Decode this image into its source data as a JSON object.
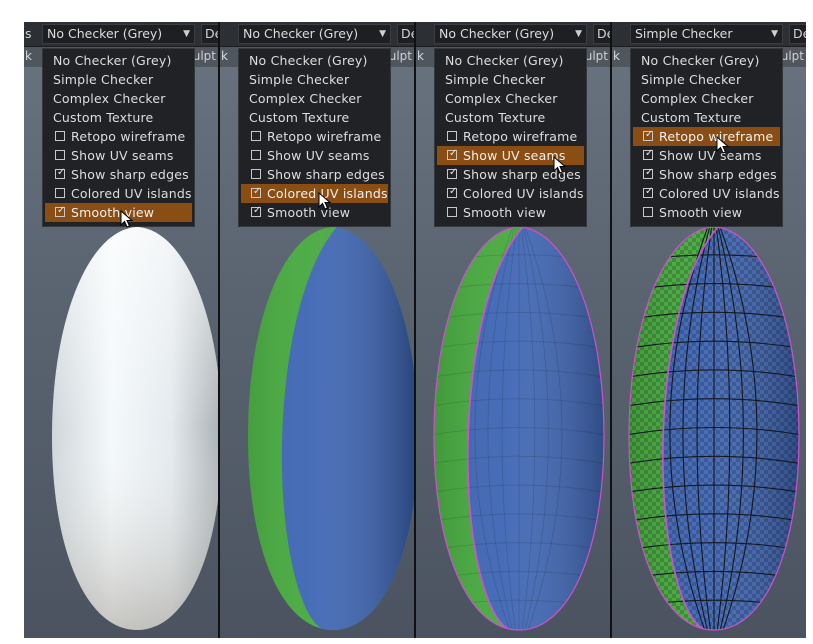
{
  "panels": [
    {
      "sub_left": "k",
      "sub_right": "Sculpt",
      "toolbar_left": "s",
      "combo_value": "No Checker (Grey)",
      "toolbar_right": "Des",
      "menu": {
        "options": [
          "No Checker (Grey)",
          "Simple Checker",
          "Complex Checker",
          "Custom Texture"
        ],
        "toggles": [
          {
            "label": "Retopo  wireframe",
            "checked": false
          },
          {
            "label": "Show  UV  seams",
            "checked": false
          },
          {
            "label": "Show  sharp  edges",
            "checked": true
          },
          {
            "label": "Colored  UV  islands",
            "checked": false
          },
          {
            "label": "Smooth  view",
            "checked": true,
            "highlighted": true
          }
        ]
      },
      "model": "smooth-white"
    },
    {
      "sub_left": "k",
      "sub_right": "Sculpt",
      "toolbar_left": "",
      "combo_value": "No Checker (Grey)",
      "toolbar_right": "Des",
      "menu": {
        "options": [
          "No Checker (Grey)",
          "Simple Checker",
          "Complex Checker",
          "Custom Texture"
        ],
        "toggles": [
          {
            "label": "Retopo  wireframe",
            "checked": false
          },
          {
            "label": "Show  UV  seams",
            "checked": false
          },
          {
            "label": "Show  sharp  edges",
            "checked": false
          },
          {
            "label": "Colored  UV  islands",
            "checked": true,
            "highlighted": true
          },
          {
            "label": "Smooth  view",
            "checked": true
          }
        ]
      },
      "model": "uv-islands-smooth"
    },
    {
      "sub_left": "k",
      "sub_right": "Sculpt",
      "toolbar_left": "",
      "combo_value": "No Checker (Grey)",
      "toolbar_right": "Des",
      "menu": {
        "options": [
          "No Checker (Grey)",
          "Simple Checker",
          "Complex Checker",
          "Custom Texture"
        ],
        "toggles": [
          {
            "label": "Retopo  wireframe",
            "checked": false
          },
          {
            "label": "Show  UV  seams",
            "checked": true,
            "highlighted": true
          },
          {
            "label": "Show  sharp  edges",
            "checked": true
          },
          {
            "label": "Colored  UV  islands",
            "checked": true
          },
          {
            "label": "Smooth  view",
            "checked": false
          }
        ]
      },
      "model": "uv-seams-faceted"
    },
    {
      "sub_left": "k",
      "sub_right": "Sculpt",
      "toolbar_left": "",
      "combo_value": "Simple Checker",
      "toolbar_right": "De",
      "menu": {
        "options": [
          "No Checker (Grey)",
          "Simple Checker",
          "Complex Checker",
          "Custom Texture"
        ],
        "toggles": [
          {
            "label": "Retopo  wireframe",
            "checked": true,
            "highlighted": true
          },
          {
            "label": "Show  UV  seams",
            "checked": true
          },
          {
            "label": "Show  sharp  edges",
            "checked": true
          },
          {
            "label": "Colored  UV  islands",
            "checked": true
          },
          {
            "label": "Smooth  view",
            "checked": false
          }
        ]
      },
      "model": "checker-wireframe"
    }
  ],
  "colors": {
    "highlight": "#8a4e14",
    "uv_island_blue": "#3c64b4",
    "uv_island_green": "#44a83c",
    "seam_magenta": "#d050d0"
  },
  "icons": {
    "dropdown": "triangle-down-icon",
    "cursor": "mouse-pointer-icon",
    "check": "checkmark-icon"
  }
}
